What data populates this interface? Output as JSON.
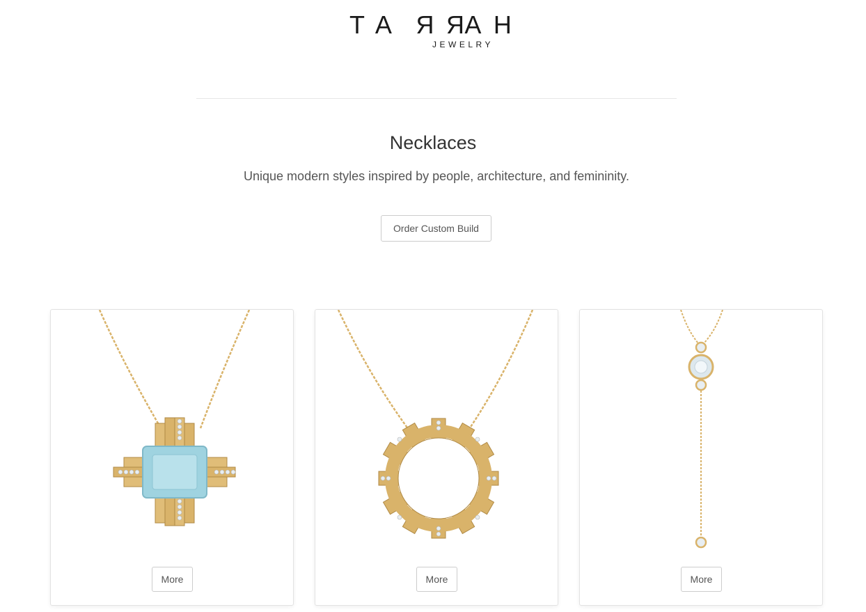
{
  "brand": {
    "name": "TARRAH",
    "tagline": "JEWELRY"
  },
  "page": {
    "title": "Necklaces",
    "subtitle": "Unique modern styles inspired by people, architecture, and femininity.",
    "cta_label": "Order Custom Build"
  },
  "products": [
    {
      "button_label": "More"
    },
    {
      "button_label": "More"
    },
    {
      "button_label": "More"
    }
  ],
  "colors": {
    "gold": "#d9b36a",
    "gold_dark": "#b08a45",
    "stone_blue": "#9fd3e0",
    "diamond": "#e8eef2",
    "text": "#333333",
    "border": "#cccccc"
  }
}
